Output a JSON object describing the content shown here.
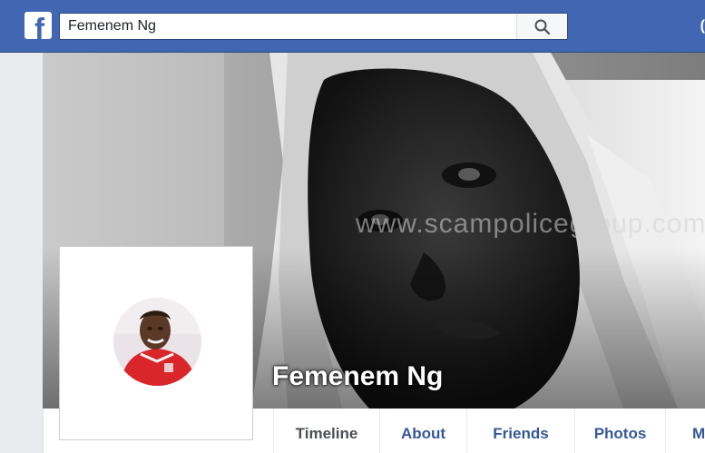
{
  "topbar": {
    "logo_letter": "f",
    "search": {
      "value": "Femenem Ng",
      "placeholder": "Search"
    },
    "edge_glyph": "("
  },
  "cover": {
    "watermark": "www.scampolicegroup.com"
  },
  "profile": {
    "name": "Femenem Ng"
  },
  "nav": {
    "tabs": [
      {
        "label": "Timeline",
        "active": true
      },
      {
        "label": "About",
        "active": false
      },
      {
        "label": "Friends",
        "active": false
      },
      {
        "label": "Photos",
        "active": false
      },
      {
        "label": "M",
        "active": false
      }
    ]
  },
  "colors": {
    "brand": "#4267b2",
    "link": "#365899",
    "page_bg": "#e9ebee"
  }
}
